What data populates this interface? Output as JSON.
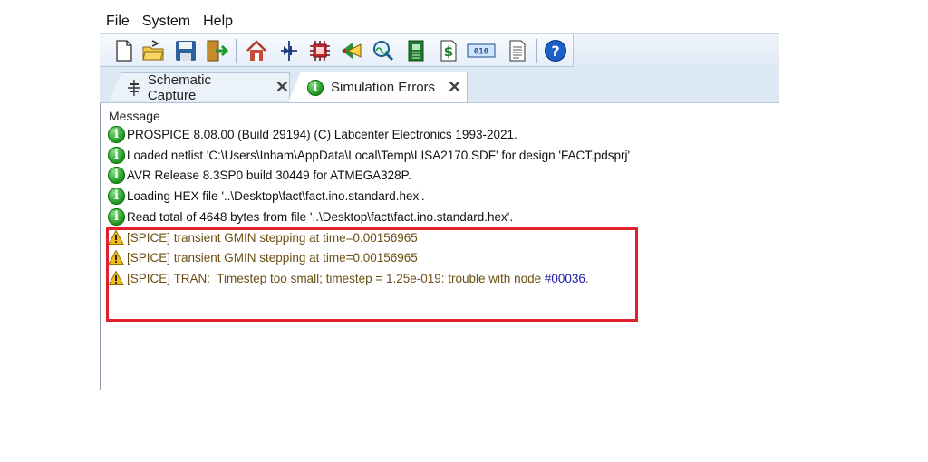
{
  "menu": [
    "File",
    "System",
    "Help"
  ],
  "toolbar": {
    "icons": [
      "new-file-icon",
      "open-folder-icon",
      "save-icon",
      "exit-icon",
      "home-icon",
      "component-icon",
      "chip-icon",
      "probe-icon",
      "zoom-icon",
      "pcb-icon",
      "bill-of-materials-icon",
      "binary-icon",
      "report-icon",
      "help-icon"
    ]
  },
  "tabs": [
    {
      "label": "Schematic Capture",
      "close": "✕"
    },
    {
      "label": "Simulation Errors",
      "close": "✕"
    }
  ],
  "messages": {
    "header": "Message",
    "rows": [
      {
        "type": "info",
        "text": "PROSPICE 8.08.00 (Build 29194) (C) Labcenter Electronics 1993-2021."
      },
      {
        "type": "info",
        "text": "Loaded netlist 'C:\\Users\\Inham\\AppData\\Local\\Temp\\LISA2170.SDF' for design 'FACT.pdsprj'"
      },
      {
        "type": "info",
        "text": "AVR Release 8.3SP0 build 30449 for ATMEGA328P."
      },
      {
        "type": "info",
        "text": "Loading HEX file '..\\Desktop\\fact\\fact.ino.standard.hex'."
      },
      {
        "type": "info",
        "text": "Read total of 4648 bytes from file '..\\Desktop\\fact\\fact.ino.standard.hex'."
      },
      {
        "type": "warn",
        "text": "[SPICE] transient GMIN stepping at time=0.00156965"
      },
      {
        "type": "warn",
        "text": "[SPICE] transient GMIN stepping at time=0.00156965"
      },
      {
        "type": "warn",
        "text": "[SPICE] TRAN:  Timestep too small; timestep = 1.25e-019: trouble with node ",
        "link": "#00036",
        "suffix": "."
      }
    ]
  },
  "colors": {
    "highlight": "#e0202a",
    "info": "#1b8f1b",
    "warn": "#e8b100",
    "link": "#1a1aa8"
  }
}
